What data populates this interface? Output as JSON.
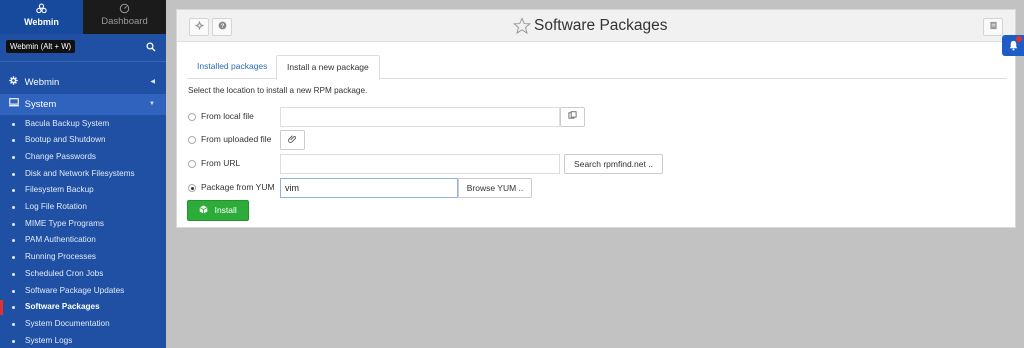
{
  "sidebar": {
    "tab_webmin": "Webmin",
    "tab_dashboard": "Dashboard",
    "tooltip": "Webmin (Alt + W)",
    "categories": [
      {
        "label": "Webmin",
        "icon": "gear-icon"
      },
      {
        "label": "System",
        "icon": "monitor-icon"
      }
    ],
    "items": [
      {
        "label": "Bacula Backup System"
      },
      {
        "label": "Bootup and Shutdown"
      },
      {
        "label": "Change Passwords"
      },
      {
        "label": "Disk and Network Filesystems"
      },
      {
        "label": "Filesystem Backup"
      },
      {
        "label": "Log File Rotation"
      },
      {
        "label": "MIME Type Programs"
      },
      {
        "label": "PAM Authentication"
      },
      {
        "label": "Running Processes"
      },
      {
        "label": "Scheduled Cron Jobs"
      },
      {
        "label": "Software Package Updates"
      },
      {
        "label": "Software Packages",
        "active": true
      },
      {
        "label": "System Documentation"
      },
      {
        "label": "System Logs"
      }
    ]
  },
  "main": {
    "title": "Software Packages",
    "tabs": [
      {
        "label": "Installed packages"
      },
      {
        "label": "Install a new package"
      }
    ],
    "instruction": "Select the location to install a new RPM package.",
    "options": [
      {
        "label": "From local file"
      },
      {
        "label": "From uploaded file"
      },
      {
        "label": "From URL",
        "button": "Search rpmfind.net .."
      },
      {
        "label": "Package from YUM",
        "value": "vim",
        "button": "Browse YUM .."
      }
    ],
    "install_label": "Install"
  },
  "colors": {
    "sidebar_bg": "#1f50a4",
    "active_marker": "#e23030",
    "install_green": "#2dac3a",
    "link_blue": "#2a6db5"
  }
}
